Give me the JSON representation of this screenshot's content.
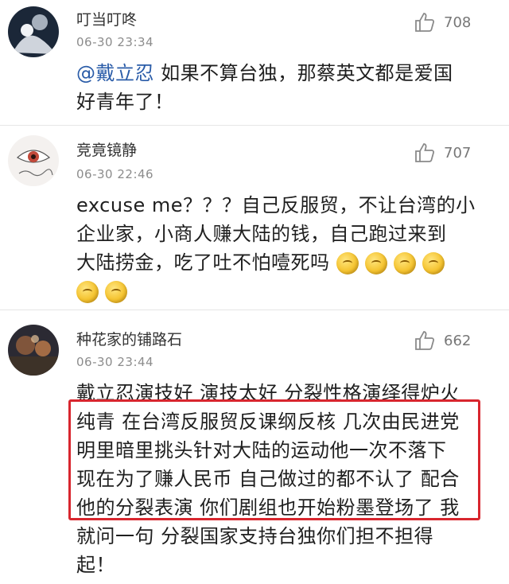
{
  "comments": [
    {
      "username": "叮当叮咚",
      "timestamp": "06-30 23:34",
      "likes": "708",
      "mention": "@戴立忍",
      "lines": [
        " 如果不算台独，那蔡英文都是爱国",
        "好青年了！"
      ]
    },
    {
      "username": "竞竟镜静",
      "timestamp": "06-30 22:46",
      "likes": "707",
      "lines": [
        "excuse me？？？自己反服贸，不让台湾的小",
        "企业家，小商人赚大陆的钱，自己跑过来到",
        "大陆捞金，吃了吐不怕噎死吗"
      ],
      "emoji_count_line3": 4,
      "emoji_count_line4": 2
    },
    {
      "username": "种花家的铺路石",
      "timestamp": "06-30 23:44",
      "likes": "662",
      "lines": [
        "戴立忍演技好 演技太好 分裂性格演绎得炉火",
        "纯青 在台湾反服贸反课纲反核 几次由民进党",
        "明里暗里挑头针对大陆的运动他一次不落下",
        "现在为了赚人民币 自己做过的都不认了 配合",
        "他的分裂表演 你们剧组也开始粉墨登场了 我",
        "就问一句 分裂国家支持台独你们担不担得",
        "起！"
      ]
    }
  ],
  "icons": {
    "like": "thumbs-up-icon"
  },
  "colors": {
    "mention": "#2a5ca8",
    "highlight": "#d8262e"
  }
}
